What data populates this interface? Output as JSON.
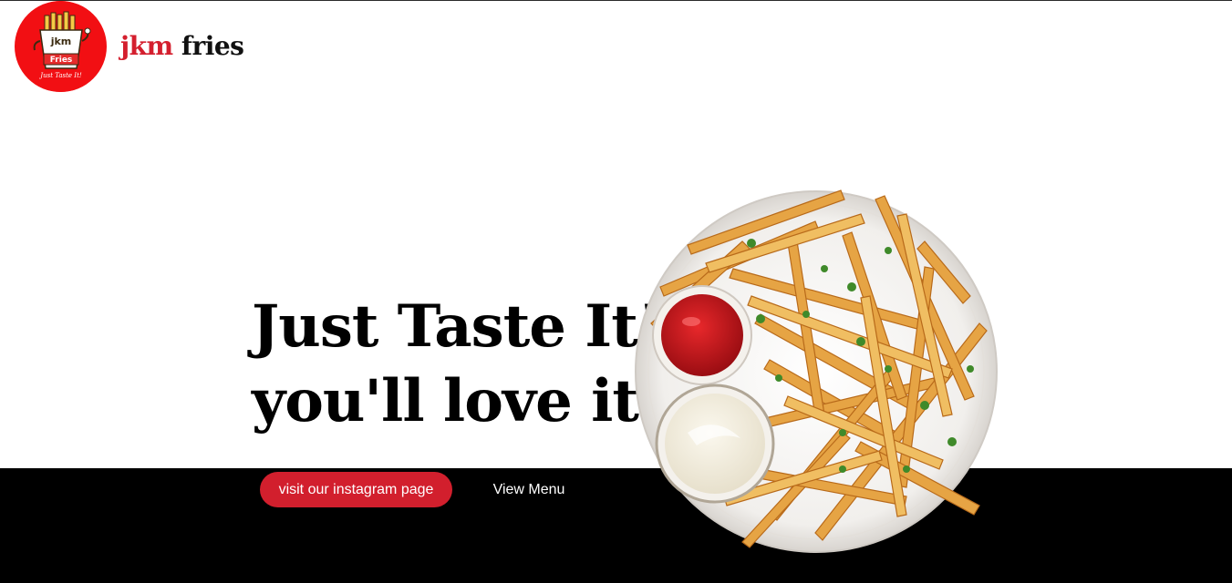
{
  "brand": {
    "name_part1": "jkm",
    "name_part2": "fries",
    "logo_text_top": "jkm",
    "logo_text_mid": "Fries",
    "logo_tagline": "Just Taste It!"
  },
  "hero": {
    "title_line1": "Just Taste It!",
    "title_line2": "you'll love it"
  },
  "actions": {
    "instagram_label": "visit our instagram page",
    "menu_label": "View Menu"
  },
  "colors": {
    "brand_red": "#d21f2d",
    "logo_red": "#f20f13",
    "band": "#000000"
  },
  "icons": {
    "logo": "fries-mascot-logo",
    "hero_image": "fries-plate-image"
  }
}
